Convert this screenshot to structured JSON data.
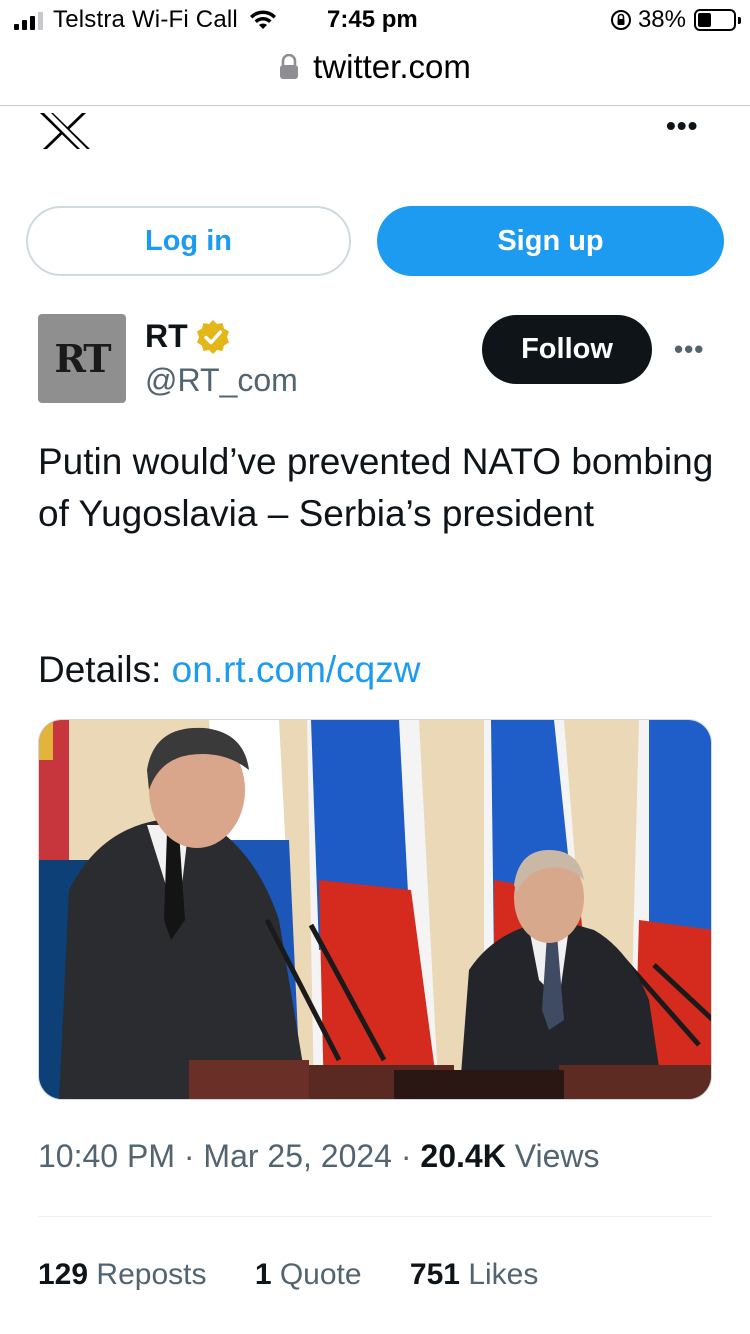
{
  "status_bar": {
    "carrier": "Telstra Wi-Fi Call",
    "time": "7:45 pm",
    "battery_percent": "38%",
    "battery_level": 0.38,
    "signal_bars_active": 3
  },
  "browser": {
    "url": "twitter.com",
    "lock_icon": "padlock-icon"
  },
  "header": {
    "logo": "x-logo-icon",
    "more_icon": "more-horizontal-icon",
    "more_glyph": "•••"
  },
  "auth": {
    "login_label": "Log in",
    "signup_label": "Sign up"
  },
  "tweet": {
    "author_name": "RT",
    "avatar_text": "RT",
    "handle": "@RT_com",
    "verified_icon": "verified-badge-icon",
    "follow_label": "Follow",
    "more_glyph": "•••",
    "text": "Putin would’ve prevented NATO bombing of Yugoslavia – Serbia’s president",
    "details_label": "Details:",
    "details_link": "on.rt.com/cqzw",
    "time": "10:40 PM",
    "separator": "·",
    "date": "Mar 25, 2024",
    "views_count": "20.4K",
    "views_label": "Views",
    "reposts_count": "129",
    "reposts_label": "Reposts",
    "quotes_count": "1",
    "quotes_label": "Quote",
    "likes_count": "751",
    "likes_label": "Likes"
  },
  "colors": {
    "twitter_blue": "#1d9bf0",
    "dark": "#0f1419",
    "secondary_text": "#536471",
    "verified_gold": "#e2b719"
  }
}
